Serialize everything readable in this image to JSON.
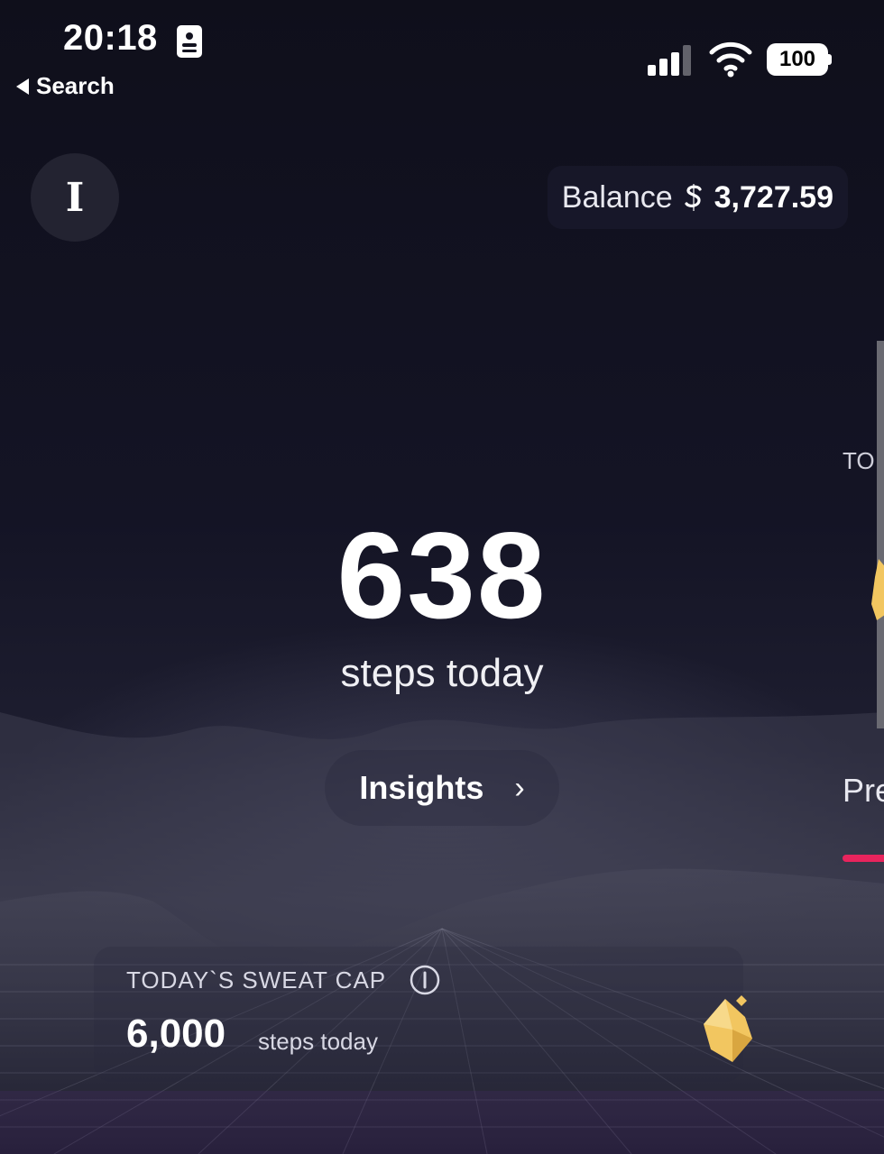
{
  "status_bar": {
    "time": "20:18",
    "back_label": "Search",
    "battery": "100",
    "icons": [
      "id-card-icon",
      "signal-icon",
      "wifi-icon",
      "battery-icon"
    ]
  },
  "header": {
    "avatar_initial": "I",
    "balance_label": "Balance",
    "balance_value": "3,727.59",
    "currency_icon": "sweat-coin-icon"
  },
  "steps": {
    "count": "638",
    "label": "steps today"
  },
  "insights": {
    "label": "Insights",
    "chevron": "›"
  },
  "side_card": {
    "title_partial": "TO",
    "label_partial": "Pre",
    "accent": "#e8245d"
  },
  "sweat_cap": {
    "title": "TODAY`S SWEAT CAP",
    "value": "6,000",
    "unit": "steps today",
    "icon": "gem-icon"
  },
  "colors": {
    "background": "#12121f",
    "gem": "#f2c660",
    "text": "#ffffff"
  }
}
